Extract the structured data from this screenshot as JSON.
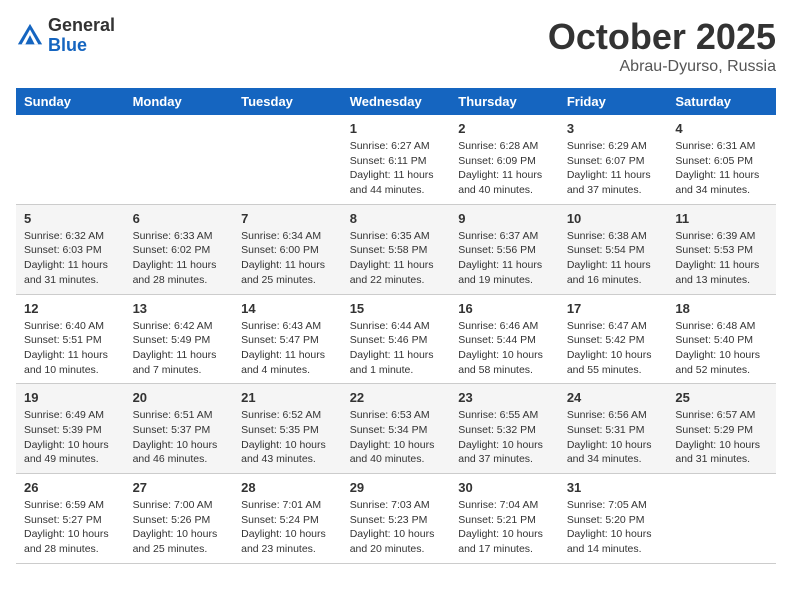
{
  "header": {
    "logo_general": "General",
    "logo_blue": "Blue",
    "title": "October 2025",
    "subtitle": "Abrau-Dyurso, Russia"
  },
  "days_of_week": [
    "Sunday",
    "Monday",
    "Tuesday",
    "Wednesday",
    "Thursday",
    "Friday",
    "Saturday"
  ],
  "weeks": [
    [
      {
        "day": "",
        "info": ""
      },
      {
        "day": "",
        "info": ""
      },
      {
        "day": "",
        "info": ""
      },
      {
        "day": "1",
        "info": "Sunrise: 6:27 AM\nSunset: 6:11 PM\nDaylight: 11 hours\nand 44 minutes."
      },
      {
        "day": "2",
        "info": "Sunrise: 6:28 AM\nSunset: 6:09 PM\nDaylight: 11 hours\nand 40 minutes."
      },
      {
        "day": "3",
        "info": "Sunrise: 6:29 AM\nSunset: 6:07 PM\nDaylight: 11 hours\nand 37 minutes."
      },
      {
        "day": "4",
        "info": "Sunrise: 6:31 AM\nSunset: 6:05 PM\nDaylight: 11 hours\nand 34 minutes."
      }
    ],
    [
      {
        "day": "5",
        "info": "Sunrise: 6:32 AM\nSunset: 6:03 PM\nDaylight: 11 hours\nand 31 minutes."
      },
      {
        "day": "6",
        "info": "Sunrise: 6:33 AM\nSunset: 6:02 PM\nDaylight: 11 hours\nand 28 minutes."
      },
      {
        "day": "7",
        "info": "Sunrise: 6:34 AM\nSunset: 6:00 PM\nDaylight: 11 hours\nand 25 minutes."
      },
      {
        "day": "8",
        "info": "Sunrise: 6:35 AM\nSunset: 5:58 PM\nDaylight: 11 hours\nand 22 minutes."
      },
      {
        "day": "9",
        "info": "Sunrise: 6:37 AM\nSunset: 5:56 PM\nDaylight: 11 hours\nand 19 minutes."
      },
      {
        "day": "10",
        "info": "Sunrise: 6:38 AM\nSunset: 5:54 PM\nDaylight: 11 hours\nand 16 minutes."
      },
      {
        "day": "11",
        "info": "Sunrise: 6:39 AM\nSunset: 5:53 PM\nDaylight: 11 hours\nand 13 minutes."
      }
    ],
    [
      {
        "day": "12",
        "info": "Sunrise: 6:40 AM\nSunset: 5:51 PM\nDaylight: 11 hours\nand 10 minutes."
      },
      {
        "day": "13",
        "info": "Sunrise: 6:42 AM\nSunset: 5:49 PM\nDaylight: 11 hours\nand 7 minutes."
      },
      {
        "day": "14",
        "info": "Sunrise: 6:43 AM\nSunset: 5:47 PM\nDaylight: 11 hours\nand 4 minutes."
      },
      {
        "day": "15",
        "info": "Sunrise: 6:44 AM\nSunset: 5:46 PM\nDaylight: 11 hours\nand 1 minute."
      },
      {
        "day": "16",
        "info": "Sunrise: 6:46 AM\nSunset: 5:44 PM\nDaylight: 10 hours\nand 58 minutes."
      },
      {
        "day": "17",
        "info": "Sunrise: 6:47 AM\nSunset: 5:42 PM\nDaylight: 10 hours\nand 55 minutes."
      },
      {
        "day": "18",
        "info": "Sunrise: 6:48 AM\nSunset: 5:40 PM\nDaylight: 10 hours\nand 52 minutes."
      }
    ],
    [
      {
        "day": "19",
        "info": "Sunrise: 6:49 AM\nSunset: 5:39 PM\nDaylight: 10 hours\nand 49 minutes."
      },
      {
        "day": "20",
        "info": "Sunrise: 6:51 AM\nSunset: 5:37 PM\nDaylight: 10 hours\nand 46 minutes."
      },
      {
        "day": "21",
        "info": "Sunrise: 6:52 AM\nSunset: 5:35 PM\nDaylight: 10 hours\nand 43 minutes."
      },
      {
        "day": "22",
        "info": "Sunrise: 6:53 AM\nSunset: 5:34 PM\nDaylight: 10 hours\nand 40 minutes."
      },
      {
        "day": "23",
        "info": "Sunrise: 6:55 AM\nSunset: 5:32 PM\nDaylight: 10 hours\nand 37 minutes."
      },
      {
        "day": "24",
        "info": "Sunrise: 6:56 AM\nSunset: 5:31 PM\nDaylight: 10 hours\nand 34 minutes."
      },
      {
        "day": "25",
        "info": "Sunrise: 6:57 AM\nSunset: 5:29 PM\nDaylight: 10 hours\nand 31 minutes."
      }
    ],
    [
      {
        "day": "26",
        "info": "Sunrise: 6:59 AM\nSunset: 5:27 PM\nDaylight: 10 hours\nand 28 minutes."
      },
      {
        "day": "27",
        "info": "Sunrise: 7:00 AM\nSunset: 5:26 PM\nDaylight: 10 hours\nand 25 minutes."
      },
      {
        "day": "28",
        "info": "Sunrise: 7:01 AM\nSunset: 5:24 PM\nDaylight: 10 hours\nand 23 minutes."
      },
      {
        "day": "29",
        "info": "Sunrise: 7:03 AM\nSunset: 5:23 PM\nDaylight: 10 hours\nand 20 minutes."
      },
      {
        "day": "30",
        "info": "Sunrise: 7:04 AM\nSunset: 5:21 PM\nDaylight: 10 hours\nand 17 minutes."
      },
      {
        "day": "31",
        "info": "Sunrise: 7:05 AM\nSunset: 5:20 PM\nDaylight: 10 hours\nand 14 minutes."
      },
      {
        "day": "",
        "info": ""
      }
    ]
  ]
}
